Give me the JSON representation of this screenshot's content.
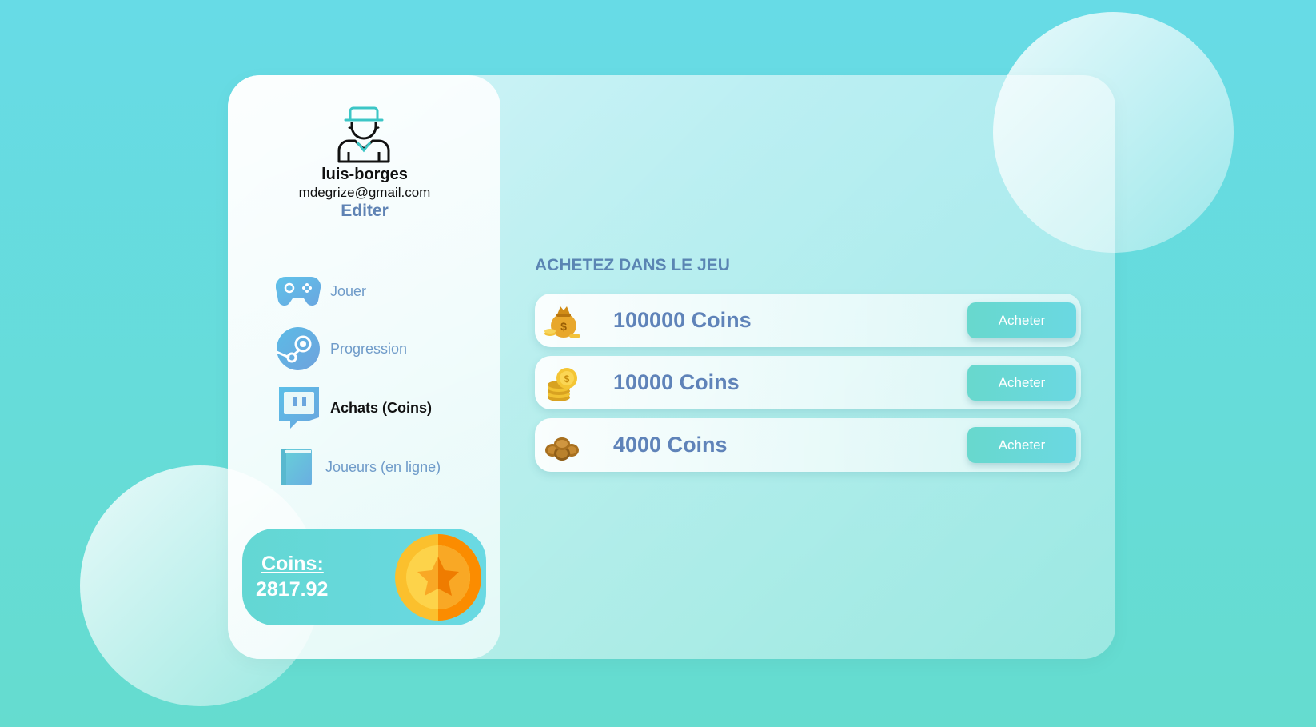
{
  "profile": {
    "username": "luis-borges",
    "email": "mdegrize@gmail.com",
    "edit_label": "Editer",
    "avatar_icon": "farmer-avatar-icon"
  },
  "nav": {
    "items": [
      {
        "label": "Jouer",
        "icon": "gamepad-icon",
        "active": false
      },
      {
        "label": "Progression",
        "icon": "steam-icon",
        "active": false
      },
      {
        "label": "Achats (Coins)",
        "icon": "twitch-icon",
        "active": true
      },
      {
        "label": "Joueurs (en ligne)",
        "icon": "book-icon",
        "active": false
      }
    ]
  },
  "balance": {
    "label": "Coins:",
    "value": "2817.92",
    "icon": "star-coin-icon"
  },
  "shop": {
    "title": "ACHETEZ DANS LE JEU",
    "items": [
      {
        "name": "100000 Coins",
        "icon": "money-bag-icon",
        "button": "Acheter"
      },
      {
        "name": "10000 Coins",
        "icon": "coin-stack-icon",
        "button": "Acheter"
      },
      {
        "name": "4000 Coins",
        "icon": "coin-pile-icon",
        "button": "Acheter"
      }
    ]
  },
  "colors": {
    "background": "#67dbe6",
    "accent": "#68d8d8",
    "nav_text": "#6f9bc9",
    "heading": "#5a85b3"
  }
}
